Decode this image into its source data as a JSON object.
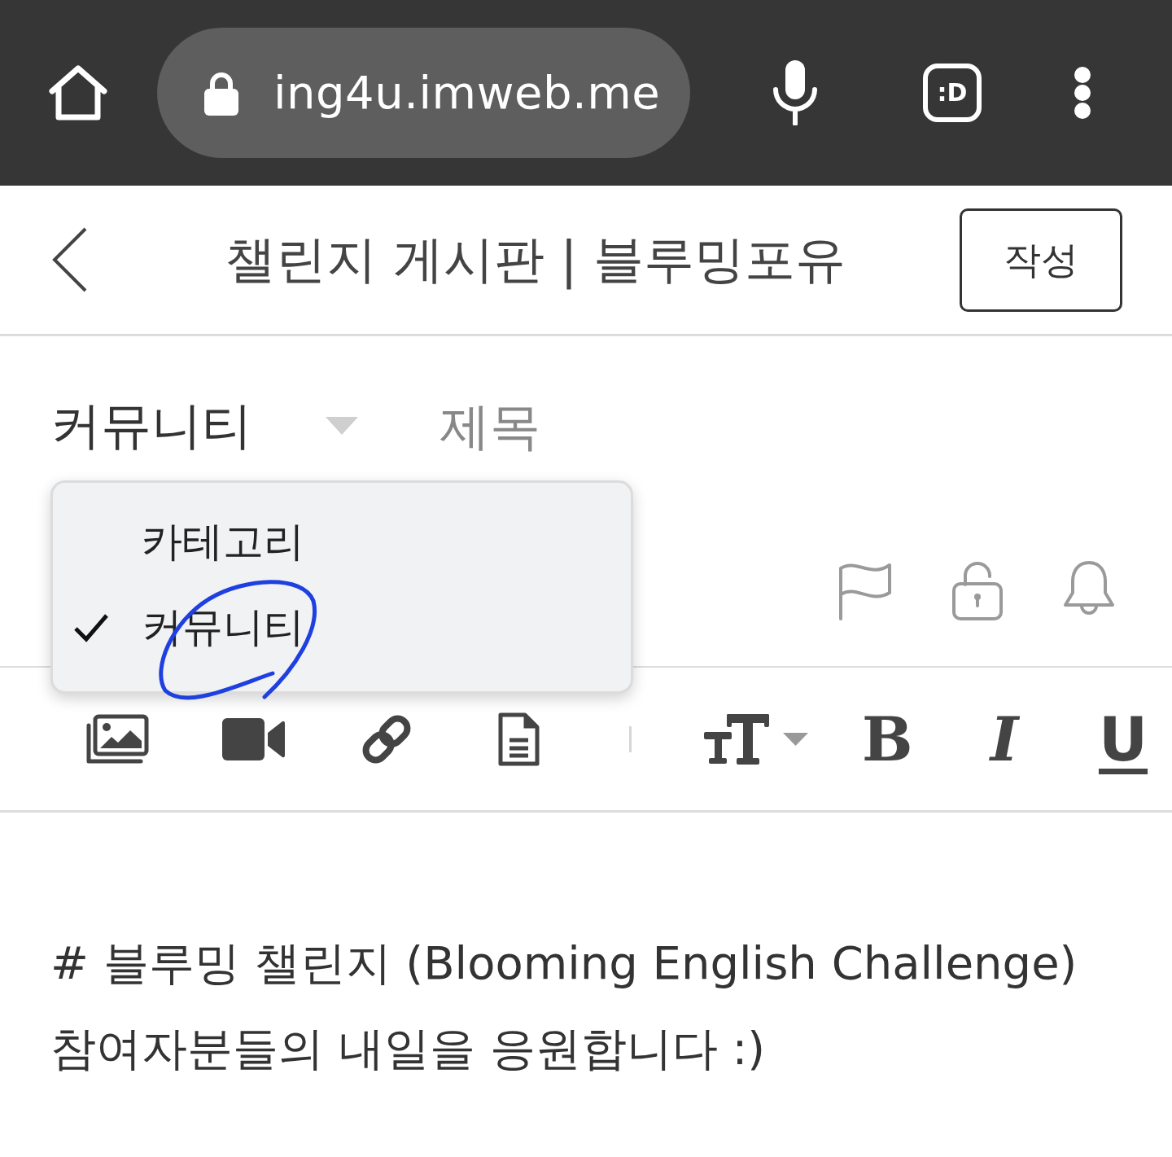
{
  "browser_bar": {
    "url": "ing4u.imweb.me",
    "extension_label": ":D"
  },
  "header": {
    "title": "챌린지 게시판 | 블루밍포유",
    "write_button": "작성"
  },
  "form": {
    "category": "커뮤니티",
    "title_field": {
      "placeholder": "제목"
    },
    "category_menu": [
      {
        "label": "카테고리",
        "selected": false
      },
      {
        "label": "커뮤니티",
        "selected": true
      }
    ]
  },
  "toolbar": {
    "format_buttons": [
      {
        "kind": "bold",
        "label": "B"
      },
      {
        "kind": "italic",
        "label": "I"
      },
      {
        "kind": "underline",
        "label": "U"
      }
    ]
  },
  "editor": {
    "lines": [
      "# 블루밍 챌린지 (Blooming English Challenge)",
      "참여자분들의 내일을 응원합니다 :)"
    ]
  }
}
